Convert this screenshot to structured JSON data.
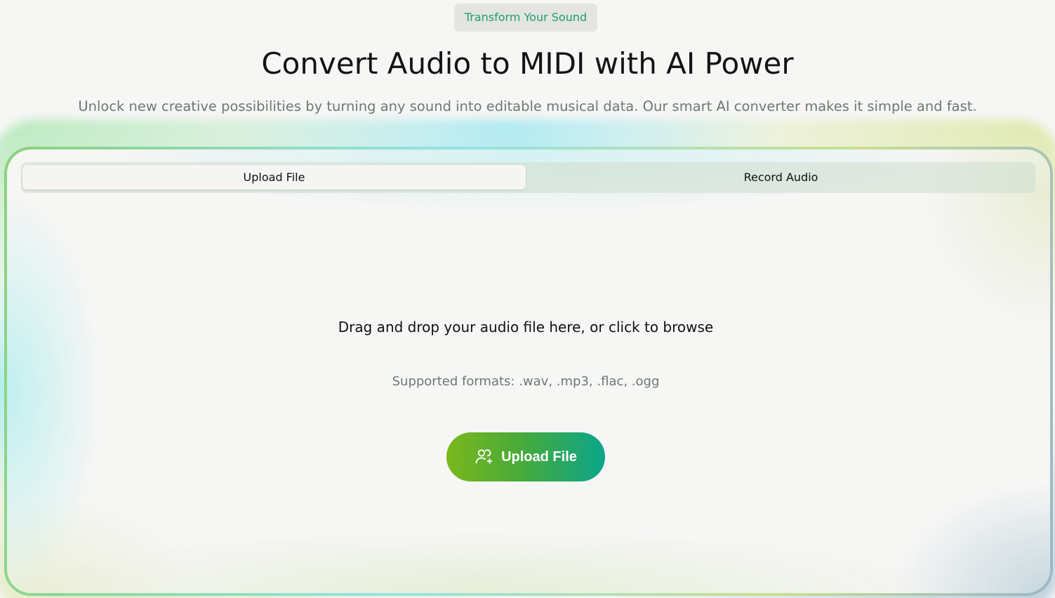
{
  "header": {
    "badge": "Transform Your Sound",
    "title": "Convert Audio to MIDI with AI Power",
    "subtitle": "Unlock new creative possibilities by turning any sound into editable musical data. Our smart AI converter makes it simple and fast."
  },
  "tabs": [
    {
      "label": "Upload File",
      "active": true
    },
    {
      "label": "Record Audio",
      "active": false
    }
  ],
  "dropzone": {
    "instruction": "Drag and drop your audio file here, or click to browse",
    "formats": "Supported formats: .wav, .mp3, .flac, .ogg",
    "button_label": "Upload File",
    "button_icon": "users-add-icon"
  },
  "colors": {
    "accent_green": "#7ab81c",
    "accent_teal": "#0aa58a",
    "badge_text": "#1f9e6e",
    "muted_text": "#6b7a72"
  }
}
